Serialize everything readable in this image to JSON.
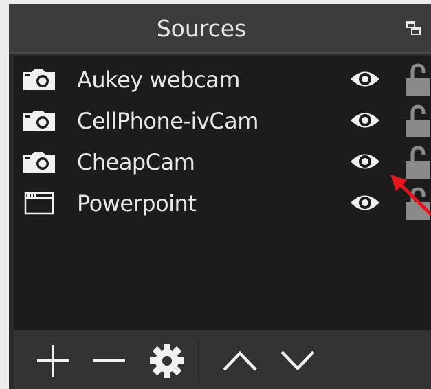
{
  "panel": {
    "title": "Sources",
    "undock_icon": "undock-window-icon"
  },
  "sources": [
    {
      "label": "Aukey webcam",
      "type_icon": "camera-icon",
      "visible": true,
      "locked": false
    },
    {
      "label": "CellPhone-ivCam",
      "type_icon": "camera-icon",
      "visible": true,
      "locked": false
    },
    {
      "label": "CheapCam",
      "type_icon": "camera-icon",
      "visible": true,
      "locked": false
    },
    {
      "label": "Powerpoint",
      "type_icon": "window-capture-icon",
      "visible": true,
      "locked": false
    }
  ],
  "toolbar": {
    "buttons": [
      {
        "icon": "plus-icon",
        "action": "add"
      },
      {
        "icon": "minus-icon",
        "action": "remove"
      },
      {
        "icon": "gear-icon",
        "action": "properties"
      },
      {
        "icon": "chevron-up-icon",
        "action": "move-up"
      },
      {
        "icon": "chevron-down-icon",
        "action": "move-down"
      }
    ]
  },
  "colors": {
    "panel_bg": "#2b2b2b",
    "header_bg": "#3c3c3c",
    "list_bg": "#1c1c1c",
    "toolbar_bg": "#333333",
    "text": "#e8e8e8",
    "icon": "#f0f0f0",
    "lock": "#8a8a8a",
    "annotation_arrow": "#e8141c"
  },
  "annotation": {
    "icon": "red-arrow-annotation"
  }
}
